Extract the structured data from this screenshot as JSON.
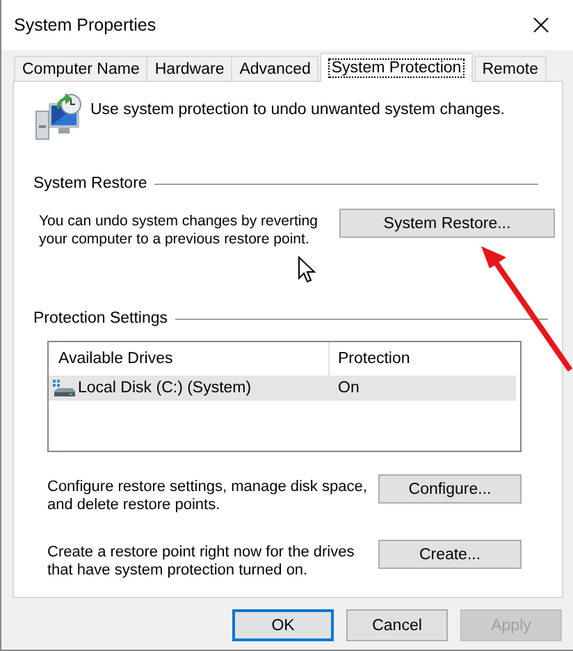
{
  "window": {
    "title": "System Properties"
  },
  "tabs": [
    {
      "label": "Computer Name",
      "selected": false
    },
    {
      "label": "Hardware",
      "selected": false
    },
    {
      "label": "Advanced",
      "selected": false
    },
    {
      "label": "System Protection",
      "selected": true
    },
    {
      "label": "Remote",
      "selected": false
    }
  ],
  "intro": "Use system protection to undo unwanted system changes.",
  "system_restore": {
    "heading": "System Restore",
    "description": "You can undo system changes by reverting your computer to a previous restore point.",
    "button": "System Restore..."
  },
  "protection_settings": {
    "heading": "Protection Settings",
    "columns": [
      "Available Drives",
      "Protection"
    ],
    "rows": [
      {
        "drive": "Local Disk (C:) (System)",
        "protection": "On",
        "selected": true
      }
    ],
    "actions": [
      {
        "description": "Configure restore settings, manage disk space, and delete restore points.",
        "button": "Configure..."
      },
      {
        "description": "Create a restore point right now for the drives that have system protection turned on.",
        "button": "Create..."
      }
    ]
  },
  "buttons": [
    {
      "label": "OK",
      "default": true,
      "disabled": false
    },
    {
      "label": "Cancel",
      "default": false,
      "disabled": false
    },
    {
      "label": "Apply",
      "default": false,
      "disabled": true
    }
  ]
}
